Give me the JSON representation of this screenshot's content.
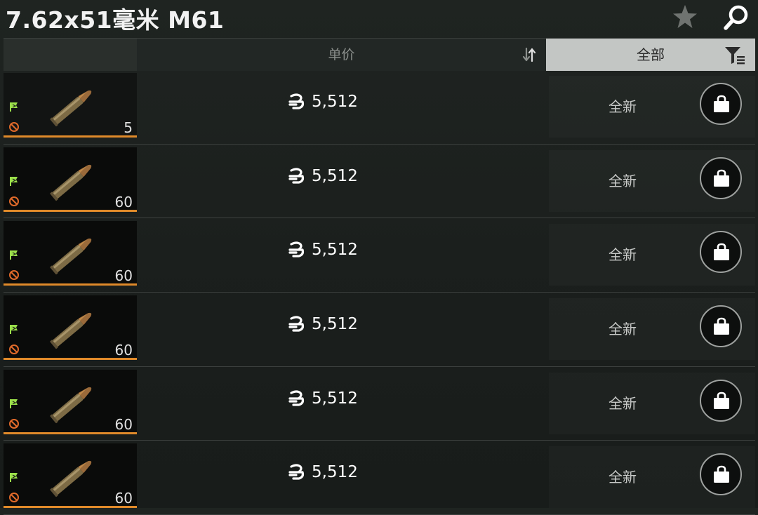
{
  "header": {
    "title": "7.62x51毫米 M61",
    "icons": {
      "favorite": "star-icon",
      "search": "search-icon"
    }
  },
  "columns": {
    "price_label": "单价",
    "filter_label": "全部",
    "icons": {
      "sort": "sort-icon",
      "filter": "filter-icon"
    }
  },
  "colors": {
    "accent_orange": "#e08a2a",
    "flag_green": "#9be04a",
    "noentry_orange": "#e06a2a"
  },
  "listings": [
    {
      "quantity": "5",
      "price": "5,512",
      "condition": "全新"
    },
    {
      "quantity": "60",
      "price": "5,512",
      "condition": "全新"
    },
    {
      "quantity": "60",
      "price": "5,512",
      "condition": "全新"
    },
    {
      "quantity": "60",
      "price": "5,512",
      "condition": "全新"
    },
    {
      "quantity": "60",
      "price": "5,512",
      "condition": "全新"
    },
    {
      "quantity": "60",
      "price": "5,512",
      "condition": "全新"
    }
  ]
}
